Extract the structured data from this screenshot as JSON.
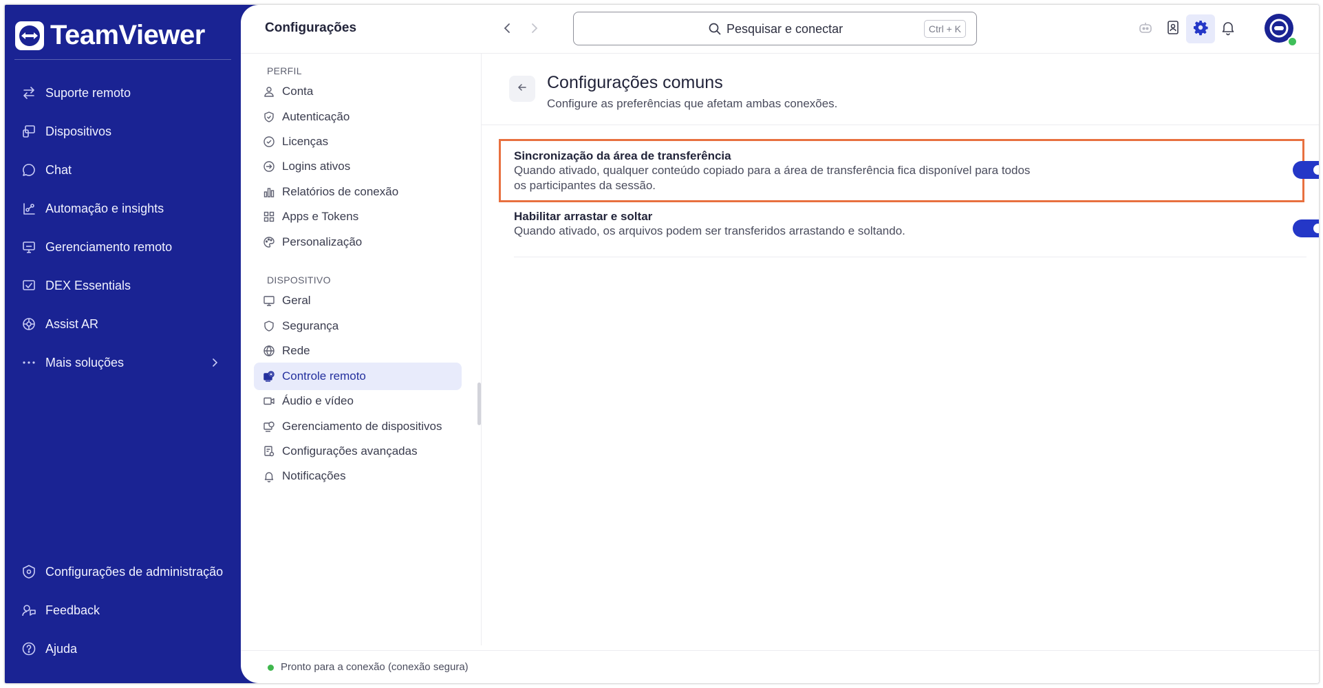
{
  "app": {
    "logo_text": "TeamViewer"
  },
  "sidebar": {
    "items": [
      {
        "label": "Suporte remoto",
        "icon": "arrows-swap-icon"
      },
      {
        "label": "Dispositivos",
        "icon": "devices-icon"
      },
      {
        "label": "Chat",
        "icon": "chat-icon"
      },
      {
        "label": "Automação e insights",
        "icon": "automation-icon"
      },
      {
        "label": "Gerenciamento remoto",
        "icon": "remote-management-icon"
      },
      {
        "label": "DEX Essentials",
        "icon": "dex-icon"
      },
      {
        "label": "Assist AR",
        "icon": "assist-ar-icon"
      },
      {
        "label": "Mais soluções",
        "icon": "more-dots-icon"
      }
    ],
    "bottom_items": [
      {
        "label": "Configurações de administração",
        "icon": "admin-settings-icon"
      },
      {
        "label": "Feedback",
        "icon": "feedback-icon"
      },
      {
        "label": "Ajuda",
        "icon": "help-icon"
      }
    ]
  },
  "header": {
    "title": "Configurações",
    "search_placeholder": "Pesquisar e conectar",
    "search_shortcut": "Ctrl + K"
  },
  "settings_nav": {
    "profile_label": "PERFIL",
    "profile_items": [
      {
        "label": "Conta",
        "icon": "user-icon"
      },
      {
        "label": "Autenticação",
        "icon": "shield-check-icon"
      },
      {
        "label": "Licenças",
        "icon": "badge-check-icon"
      },
      {
        "label": "Logins ativos",
        "icon": "login-arrow-icon"
      },
      {
        "label": "Relatórios de conexão",
        "icon": "bar-chart-icon"
      },
      {
        "label": "Apps e Tokens",
        "icon": "apps-grid-icon"
      },
      {
        "label": "Personalização",
        "icon": "palette-icon"
      }
    ],
    "device_label": "DISPOSITIVO",
    "device_items": [
      {
        "label": "Geral",
        "icon": "monitor-icon"
      },
      {
        "label": "Segurança",
        "icon": "shield-icon"
      },
      {
        "label": "Rede",
        "icon": "globe-icon"
      },
      {
        "label": "Controle remoto",
        "icon": "remote-control-icon"
      },
      {
        "label": "Áudio e vídeo",
        "icon": "video-camera-icon"
      },
      {
        "label": "Gerenciamento de dispositivos",
        "icon": "device-management-icon"
      },
      {
        "label": "Configurações avançadas",
        "icon": "advanced-settings-icon"
      },
      {
        "label": "Notificações",
        "icon": "bell-icon"
      }
    ],
    "selected": "Controle remoto"
  },
  "content": {
    "title": "Configurações comuns",
    "subtitle": "Configure as preferências que afetam ambas conexões.",
    "settings": [
      {
        "name": "Sincronização da área de transferência",
        "description": "Quando ativado, qualquer conteúdo copiado para a área de transferência fica disponível para todos os participantes da sessão.",
        "enabled": true,
        "highlighted": true
      },
      {
        "name": "Habilitar arrastar e soltar",
        "description": "Quando ativado, os arquivos podem ser transferidos arrastando e soltando.",
        "enabled": true,
        "highlighted": false
      }
    ]
  },
  "status": {
    "text": "Pronto para a conexão (conexão segura)",
    "color": "#3fb74d"
  },
  "colors": {
    "sidebar_bg": "#1a2393",
    "accent": "#2437c7",
    "highlight_border": "#e8703f"
  }
}
